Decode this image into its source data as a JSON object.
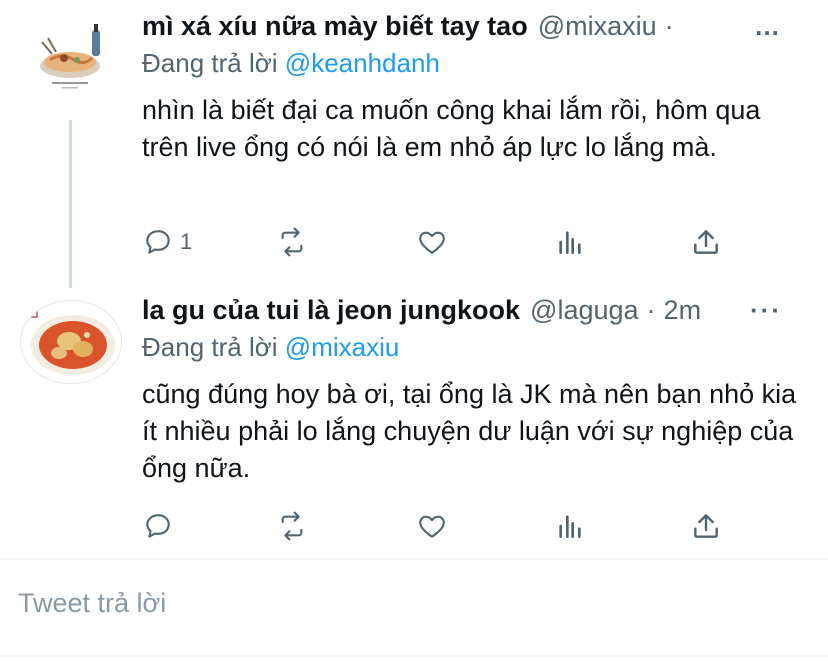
{
  "tweets": [
    {
      "name": "mì xá xíu nữa mày biết tay tao",
      "handle": "@mixaxiu",
      "separator": "·",
      "time": "",
      "more": "…",
      "replying_prefix": "Đang trả lời",
      "replying_to": "@keanhdanh",
      "text": "nhìn là biết đại ca muốn công khai lắm rồi, hôm qua trên live ổng có nói là em nhỏ áp lực lo lắng mà.",
      "reply_count": "1",
      "avatar": "food-illustration-noodles"
    },
    {
      "name": "la gu của tui là jeon jungkook",
      "handle": "@laguga",
      "separator": "·",
      "time": "2m",
      "more": "···",
      "replying_prefix": "Đang trả lời",
      "replying_to": "@mixaxiu",
      "text": "cũng đúng hoy bà ơi, tại ổng là JK mà nên bạn nhỏ kia ít nhiều phải lo lắng chuyện dư luận với sự nghiệp của ổng nữa.",
      "reply_count": "",
      "avatar": "food-illustration-stew"
    }
  ],
  "reply_box": {
    "placeholder": "Tweet trả lời"
  },
  "colors": {
    "accent": "#1d9bf0",
    "muted": "#536471",
    "text": "#0f1419"
  },
  "icons": [
    "reply-icon",
    "retweet-icon",
    "like-icon",
    "analytics-icon",
    "share-icon"
  ]
}
